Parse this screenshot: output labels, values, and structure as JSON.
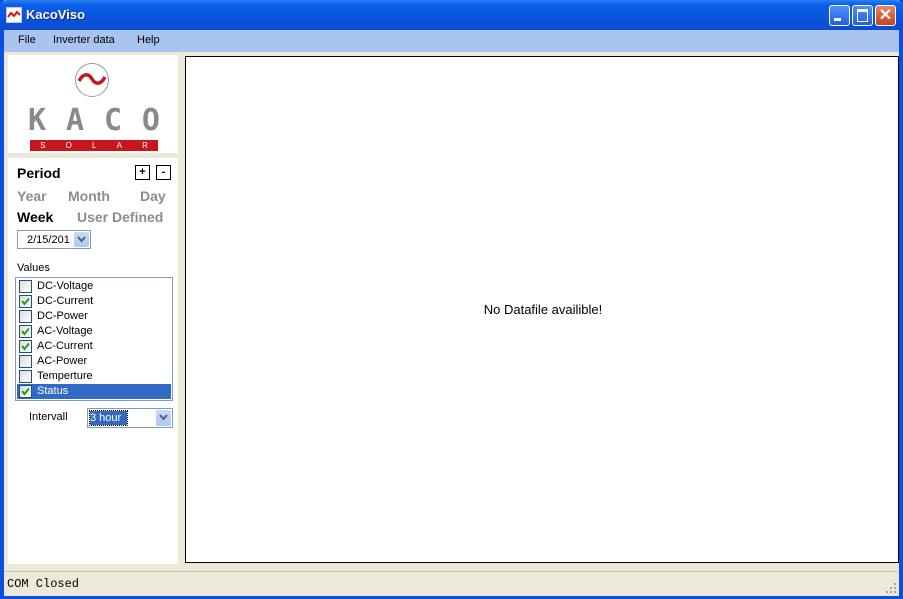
{
  "window": {
    "title": "KacoViso",
    "controls": [
      "minimize",
      "maximize",
      "close"
    ],
    "close_glyph": "✕"
  },
  "menubar": {
    "items": [
      "File",
      "Inverter data",
      "Help"
    ]
  },
  "logo": {
    "letters": [
      "K",
      "A",
      "C",
      "O"
    ],
    "subtitle_letters": [
      "S",
      "O",
      "L",
      "A",
      "R"
    ],
    "brand_color": "#c8161e"
  },
  "period": {
    "title": "Period",
    "plus_label": "+",
    "minus_label": "-",
    "options": [
      "Year",
      "Month",
      "Day",
      "Week",
      "User Defined"
    ],
    "active": "Week",
    "date_value": "2/15/201"
  },
  "values": {
    "label": "Values",
    "items": [
      {
        "label": "DC-Voltage",
        "checked": false,
        "selected": false
      },
      {
        "label": "DC-Current",
        "checked": true,
        "selected": false
      },
      {
        "label": "DC-Power",
        "checked": false,
        "selected": false
      },
      {
        "label": "AC-Voltage",
        "checked": true,
        "selected": false
      },
      {
        "label": "AC-Current",
        "checked": true,
        "selected": false
      },
      {
        "label": "AC-Power",
        "checked": false,
        "selected": false
      },
      {
        "label": "Temperture",
        "checked": false,
        "selected": false
      },
      {
        "label": "Status",
        "checked": true,
        "selected": true
      }
    ]
  },
  "interval": {
    "label": "Intervall",
    "value": "3 hour"
  },
  "main": {
    "message": "No Datafile availible!"
  },
  "statusbar": {
    "text": "COM Closed"
  },
  "colors": {
    "selection": "#316ac5",
    "titlebar": "#0a54df",
    "check": "#21a121"
  }
}
